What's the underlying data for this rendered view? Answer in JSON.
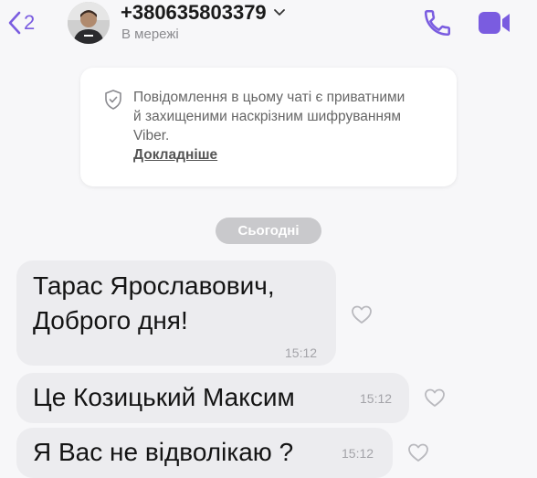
{
  "header": {
    "back_count": "2",
    "contact_name": "+380635803379",
    "status": "В мережі"
  },
  "encryption": {
    "text": "Повідомлення в цьому чаті є приватними й захищеними наскрізним шифруванням Viber.",
    "link": "Докладніше"
  },
  "date_separator": "Сьогодні",
  "messages": [
    {
      "line1": "Тарас Ярославович,",
      "line2": "Доброго дня!",
      "time": "15:12"
    },
    {
      "text": "Це Козицький Максим",
      "time": "15:12"
    },
    {
      "text": "Я Вас не відволікаю ?",
      "time": "15:12"
    }
  ],
  "colors": {
    "accent": "#7a5ce0",
    "bubble": "#ececef",
    "background": "#f7f7f9"
  },
  "icons": [
    "back-chevron-icon",
    "chevron-down-icon",
    "phone-icon",
    "video-camera-icon",
    "shield-lock-icon",
    "heart-icon"
  ]
}
